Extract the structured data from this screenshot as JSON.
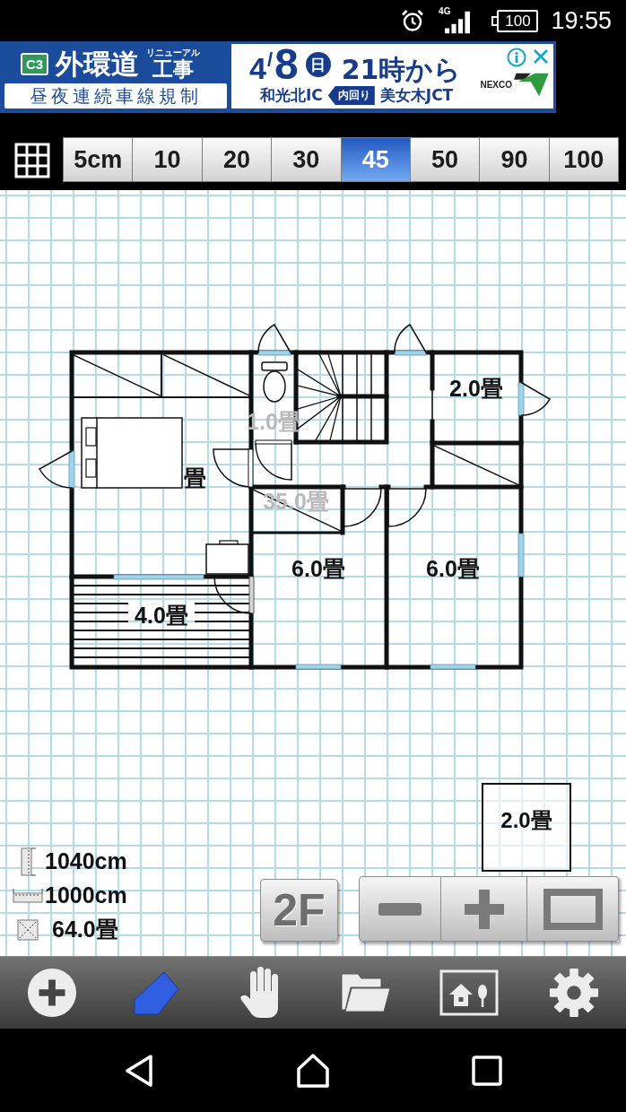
{
  "status_bar": {
    "network": "4G",
    "battery": "100",
    "time": "19:55"
  },
  "ad_banner": {
    "route": "C3",
    "title": "外環道",
    "title_note": "リニューアル",
    "title_suffix": "工事",
    "subtitle": "昼夜連続車線規制",
    "month": "4",
    "separator": "/",
    "day": "8",
    "weekday": "日",
    "start_time": "21時から",
    "from": "和光北IC",
    "direction": "内回り",
    "to": "美女木JCT",
    "logo": "NEXCO"
  },
  "grid_sizes": [
    {
      "label": "5cm",
      "selected": false
    },
    {
      "label": "10",
      "selected": false
    },
    {
      "label": "20",
      "selected": false
    },
    {
      "label": "30",
      "selected": false
    },
    {
      "label": "45",
      "selected": true
    },
    {
      "label": "50",
      "selected": false
    },
    {
      "label": "90",
      "selected": false
    },
    {
      "label": "100",
      "selected": false
    }
  ],
  "floor_plan": {
    "rooms": [
      {
        "label": "1.0畳",
        "dimmed": true
      },
      {
        "label": "2.0畳",
        "dimmed": false
      },
      {
        "label": "畳",
        "dimmed": false
      },
      {
        "label": "35.0畳",
        "dimmed": true
      },
      {
        "label": "6.0畳",
        "dimmed": false
      },
      {
        "label": "6.0畳",
        "dimmed": false
      },
      {
        "label": "4.0畳",
        "dimmed": false
      }
    ]
  },
  "template_room": {
    "label": "2.0畳"
  },
  "summary": {
    "depth": "1040cm",
    "width": "1000cm",
    "area": "64.0畳"
  },
  "floor_button": {
    "label": "2F"
  },
  "tools": [
    {
      "kind": "add",
      "selected": false
    },
    {
      "kind": "draw",
      "selected": true
    },
    {
      "kind": "pan",
      "selected": false
    },
    {
      "kind": "open",
      "selected": false
    },
    {
      "kind": "preview",
      "selected": false
    },
    {
      "kind": "settings",
      "selected": false
    }
  ]
}
